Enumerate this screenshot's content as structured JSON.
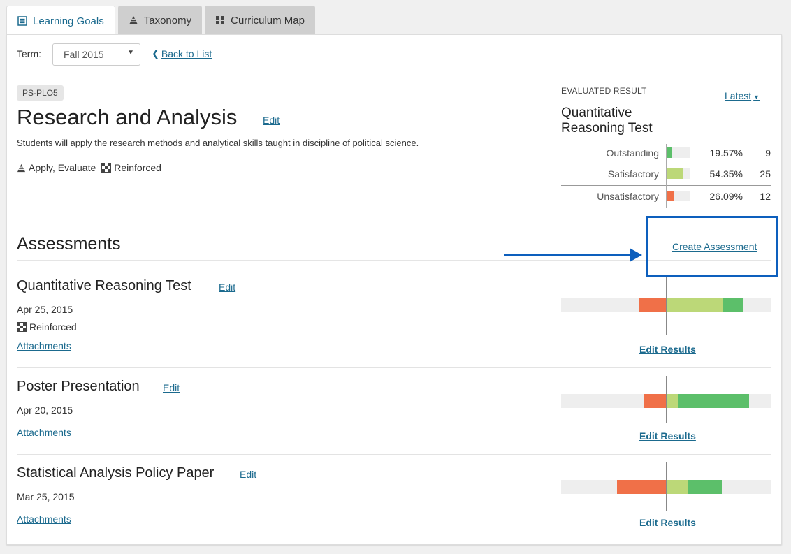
{
  "tabs": [
    {
      "label": "Learning Goals",
      "icon": "list-icon",
      "active": true
    },
    {
      "label": "Taxonomy",
      "icon": "pyramid-icon",
      "active": false
    },
    {
      "label": "Curriculum Map",
      "icon": "grid-icon",
      "active": false
    }
  ],
  "term": {
    "label": "Term:",
    "value": "Fall 2015",
    "back_label": "Back to List"
  },
  "goal": {
    "code": "PS-PLO5",
    "title": "Research and Analysis",
    "edit_label": "Edit",
    "description": "Students will apply the research methods and analytical skills taught in discipline of political science.",
    "taxonomy": "Apply, Evaluate",
    "level": "Reinforced"
  },
  "evaluated": {
    "label": "EVALUATED RESULT",
    "latest_label": "Latest",
    "title": "Quantitative Reasoning Test",
    "rows": [
      {
        "name": "Outstanding",
        "percent": "19.57%",
        "count": "9",
        "fraction": 0.1957,
        "color": "#5cbf6a"
      },
      {
        "name": "Satisfactory",
        "percent": "54.35%",
        "count": "25",
        "fraction": 0.5435,
        "color": "#bcd878"
      },
      {
        "name": "Unsatisfactory",
        "percent": "26.09%",
        "count": "12",
        "fraction": 0.2609,
        "color": "#f07048"
      }
    ]
  },
  "assessments": {
    "heading": "Assessments",
    "create_label": "Create Assessment",
    "edit_label": "Edit",
    "attachments_label": "Attachments",
    "edit_results_label": "Edit Results",
    "items": [
      {
        "title": "Quantitative Reasoning Test",
        "date": "Apr 25, 2015",
        "level": "Reinforced",
        "results": {
          "unsatisfactory": 0.2609,
          "satisfactory": 0.5435,
          "outstanding": 0.1957
        }
      },
      {
        "title": "Poster Presentation",
        "date": "Apr 20, 2015",
        "level": "",
        "results": {
          "unsatisfactory": 0.21,
          "satisfactory": 0.12,
          "outstanding": 0.67
        }
      },
      {
        "title": "Statistical Analysis Policy Paper",
        "date": "Mar 25, 2015",
        "level": "",
        "results": {
          "unsatisfactory": 0.47,
          "satisfactory": 0.21,
          "outstanding": 0.32
        }
      }
    ]
  },
  "colors": {
    "unsatisfactory": "#f07048",
    "satisfactory": "#bcd878",
    "outstanding": "#5cbf6a",
    "accent": "#1b6a8e",
    "highlight": "#0d5fbd"
  }
}
